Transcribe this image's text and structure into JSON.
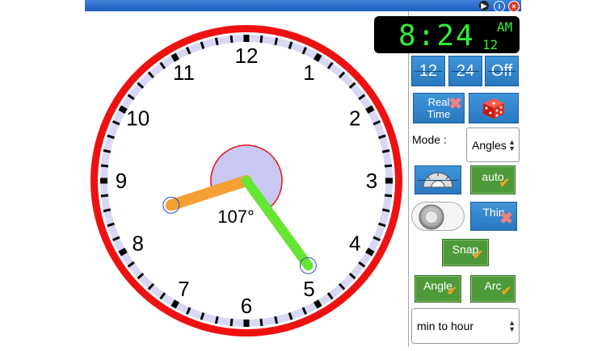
{
  "window": {
    "icons": [
      "play-icon",
      "info-icon",
      "close-icon"
    ],
    "info_glyph": "i",
    "close_glyph": "×",
    "play_glyph": "▶"
  },
  "clock": {
    "numbers": [
      "12",
      "1",
      "2",
      "3",
      "4",
      "5",
      "6",
      "7",
      "8",
      "9",
      "10",
      "11"
    ],
    "hour_hand_color": "#f5a033",
    "minute_hand_color": "#66e633",
    "rim_color": "#ee1111",
    "angle_label": "107°",
    "time": {
      "hours": 8,
      "minutes": 24
    }
  },
  "digital": {
    "time": "8:24",
    "ampm": "AM",
    "format": "12"
  },
  "buttons": {
    "format_12": "12",
    "format_24": "24",
    "format_off": "Off",
    "real_time": "Real Time",
    "real_time_line1": "Real",
    "real_time_line2": "Time",
    "thin": "Thin",
    "auto": "auto",
    "snap": "Snap",
    "angle": "Angle",
    "arc": "Arc"
  },
  "mode": {
    "label": "Mode :",
    "selected": "Angles"
  },
  "measure_select": {
    "selected": "min to hour"
  },
  "icons": {
    "dice": "dice-icon",
    "protractor": "protractor-icon",
    "toggle": "toggle-knob-icon"
  }
}
